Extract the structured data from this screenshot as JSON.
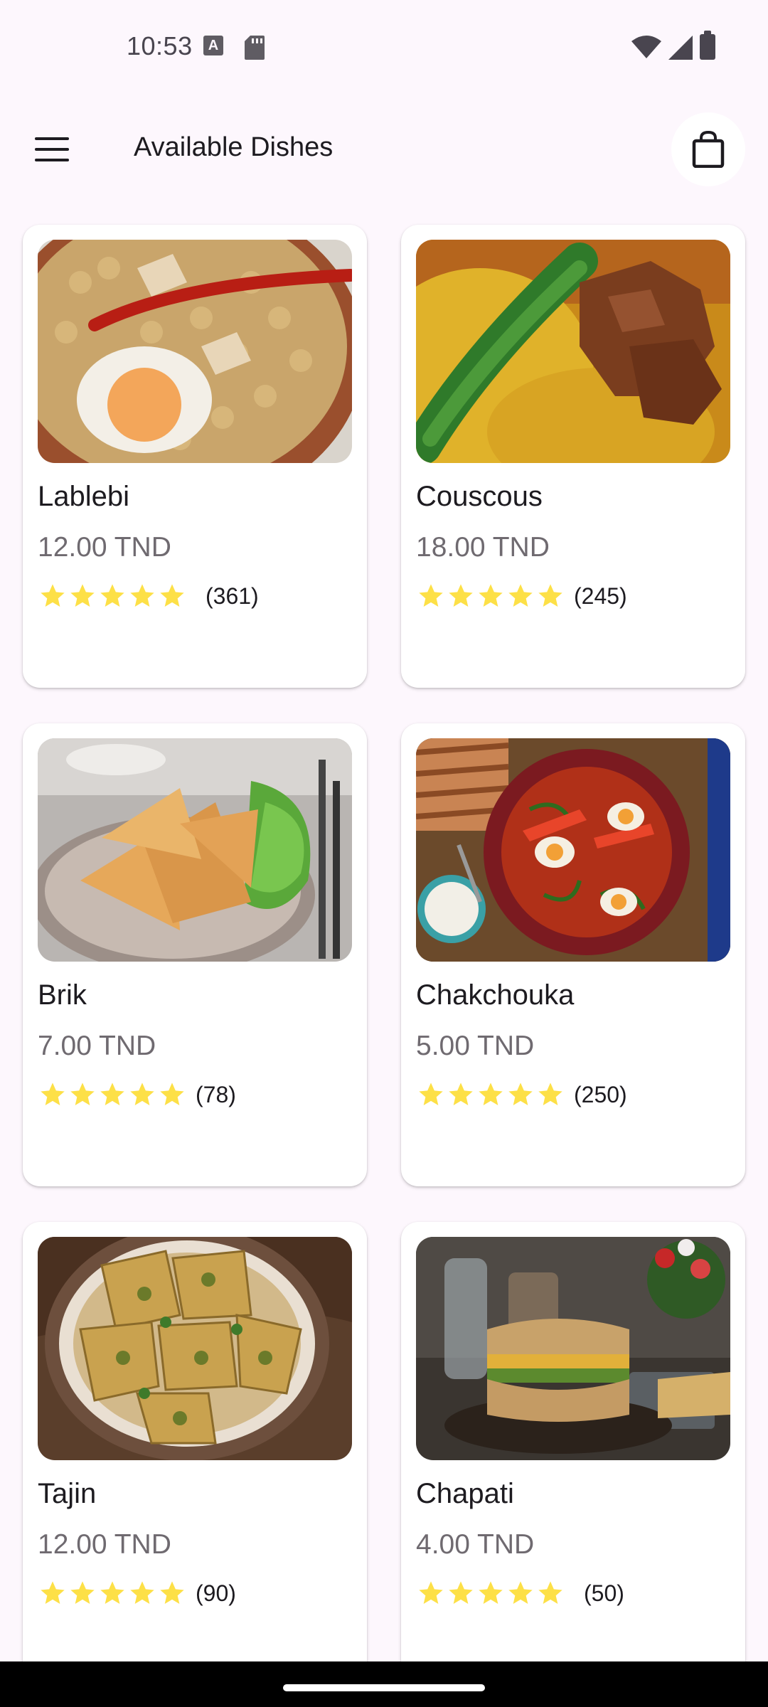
{
  "status_bar": {
    "time": "10:53",
    "icons": [
      "accessibility-a-icon",
      "sd-card-icon",
      "wifi-icon",
      "signal-icon",
      "battery-icon"
    ]
  },
  "app_bar": {
    "title": "Available Dishes",
    "menu_icon": "hamburger-menu-icon",
    "cart_icon": "shopping-bag-icon"
  },
  "colors": {
    "background": "#fdf7fd",
    "card": "#ffffff",
    "star": "#fde047",
    "price_text": "#6f6a70"
  },
  "dishes": [
    {
      "name": "Lablebi",
      "price": "12.00 TND",
      "rating_count": "(361)",
      "stars": 5
    },
    {
      "name": "Couscous",
      "price": "18.00 TND",
      "rating_count": "(245)",
      "stars": 5
    },
    {
      "name": "Brik",
      "price": "7.00 TND",
      "rating_count": "(78)",
      "stars": 5
    },
    {
      "name": "Chakchouka",
      "price": "5.00 TND",
      "rating_count": "(250)",
      "stars": 5
    },
    {
      "name": "Tajin",
      "price": "12.00 TND",
      "rating_count": "(90)",
      "stars": 5
    },
    {
      "name": "Chapati",
      "price": "4.00 TND",
      "rating_count": "(50)",
      "stars": 5
    }
  ]
}
